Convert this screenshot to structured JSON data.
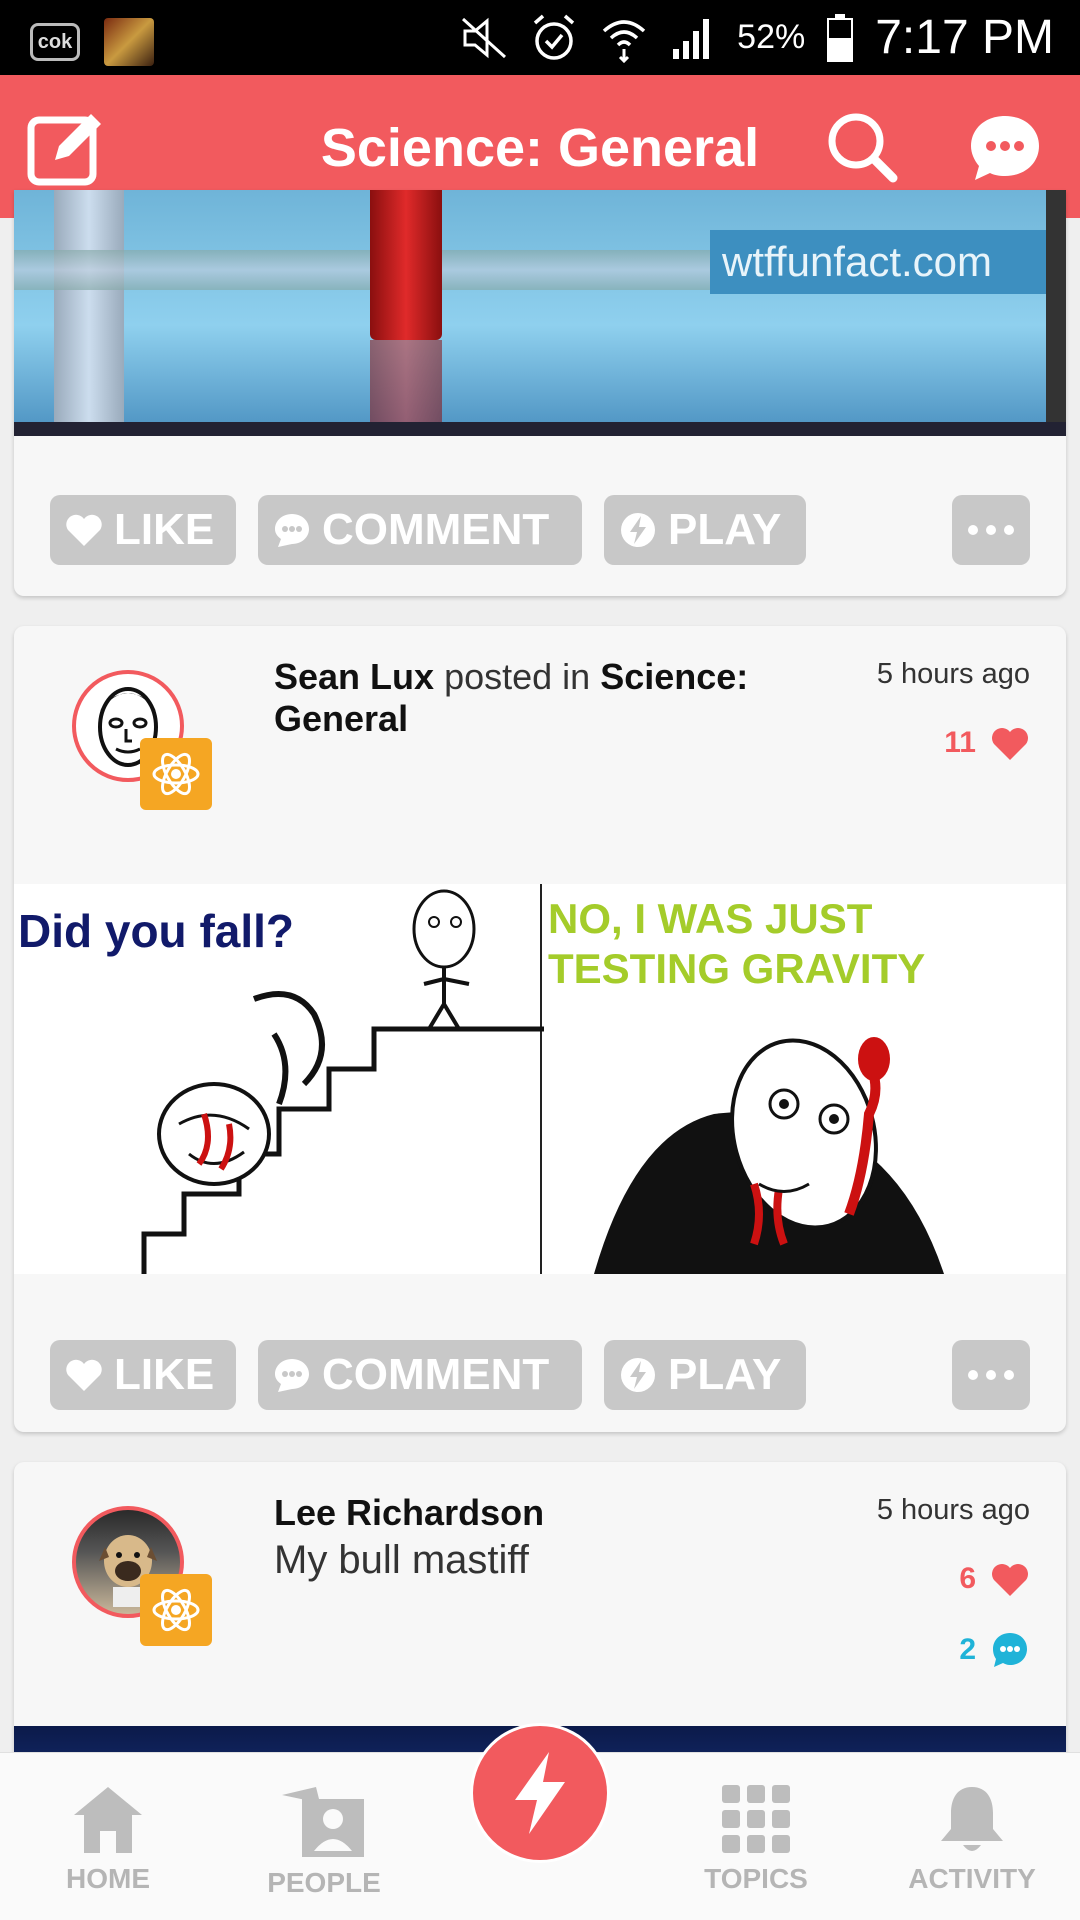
{
  "status_bar": {
    "app_badge": "cok",
    "battery": "52%",
    "time": "7:17 PM"
  },
  "header": {
    "title": "Science: General"
  },
  "actions": {
    "like": "LIKE",
    "comment": "COMMENT",
    "play": "PLAY"
  },
  "post1": {
    "image_watermark": "wtffunfact.com"
  },
  "post2": {
    "author": "Sean Lux",
    "posted_in": "posted in",
    "community": "Science: General",
    "time": "5 hours ago",
    "likes": "11",
    "image_left_text": "Did you fall?",
    "image_right_text": "NO, I WAS JUST TESTING GRAVITY"
  },
  "post3": {
    "author": "Lee Richardson",
    "body": "My bull mastiff",
    "time": "5 hours ago",
    "likes": "6",
    "comments": "2"
  },
  "bottom_nav": {
    "home": "HOME",
    "people": "PEOPLE",
    "topics": "TOPICS",
    "activity": "ACTIVITY"
  },
  "colors": {
    "brand": "#f25a5e",
    "badge": "#f5a623",
    "comment_blue": "#1fb3d8",
    "button_gray": "#c8c8c8"
  }
}
